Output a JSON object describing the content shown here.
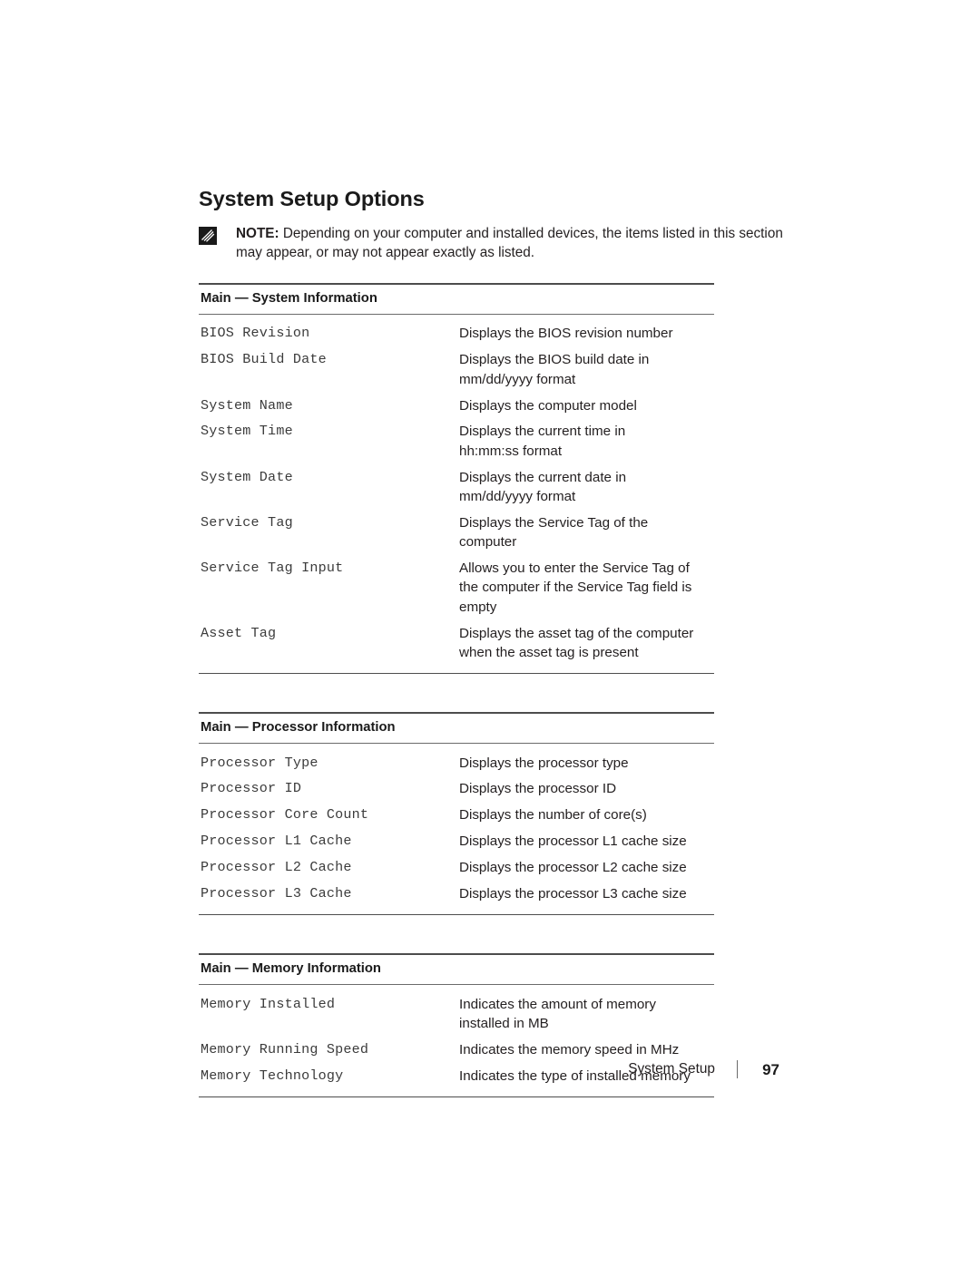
{
  "document": {
    "page_title": "System Setup Options",
    "note": {
      "icon": "note-icon",
      "label": "NOTE:",
      "text": " Depending on your computer and installed devices, the items listed in this section may appear, or may not appear exactly as listed."
    },
    "tables": [
      {
        "heading": "Main — System Information",
        "rows": [
          {
            "key": "BIOS Revision",
            "desc": [
              "Displays the BIOS revision number"
            ]
          },
          {
            "key": "BIOS Build Date",
            "desc": [
              "Displays the BIOS build date in",
              "mm/dd/yyyy format"
            ]
          },
          {
            "key": "System Name",
            "desc": [
              "Displays the computer model"
            ]
          },
          {
            "key": "System Time",
            "desc": [
              "Displays the current time in",
              "hh:mm:ss format"
            ]
          },
          {
            "key": "System Date",
            "desc": [
              "Displays the current date in",
              "mm/dd/yyyy format"
            ]
          },
          {
            "key": "Service Tag",
            "desc": [
              "Displays the Service Tag of the",
              "computer"
            ]
          },
          {
            "key": "Service Tag Input",
            "desc": [
              "Allows you to enter the Service Tag of",
              "the computer if the Service Tag field is",
              "empty"
            ]
          },
          {
            "key": "Asset Tag",
            "desc": [
              "Displays the asset tag of the computer",
              "when the asset tag is present"
            ]
          }
        ]
      },
      {
        "heading": "Main — Processor Information",
        "rows": [
          {
            "key": "Processor Type",
            "desc": [
              "Displays the processor type"
            ]
          },
          {
            "key": "Processor ID",
            "desc": [
              "Displays the processor ID"
            ]
          },
          {
            "key": "Processor Core Count",
            "desc": [
              "Displays the number of core(s)"
            ]
          },
          {
            "key": "Processor L1 Cache",
            "desc": [
              "Displays the processor L1 cache size"
            ]
          },
          {
            "key": "Processor L2 Cache",
            "desc": [
              "Displays the processor L2 cache size"
            ]
          },
          {
            "key": "Processor L3 Cache",
            "desc": [
              "Displays the processor L3 cache size"
            ]
          }
        ]
      },
      {
        "heading": "Main — Memory Information",
        "rows": [
          {
            "key": "Memory Installed",
            "desc": [
              "Indicates the amount of memory",
              "installed in MB"
            ]
          },
          {
            "key": "Memory Running Speed",
            "desc": [
              "Indicates the memory speed in MHz"
            ]
          },
          {
            "key": "Memory Technology",
            "desc": [
              "Indicates the type of installed memory"
            ]
          }
        ]
      }
    ],
    "footer": {
      "label": "System Setup",
      "separator": "|",
      "page_number": "97"
    },
    "colors": {
      "text": "#231f20",
      "mono_text": "#3b3b3b",
      "rule": "#4d4d4d",
      "rule_light": "#6b6b6b",
      "background": "#ffffff"
    }
  }
}
